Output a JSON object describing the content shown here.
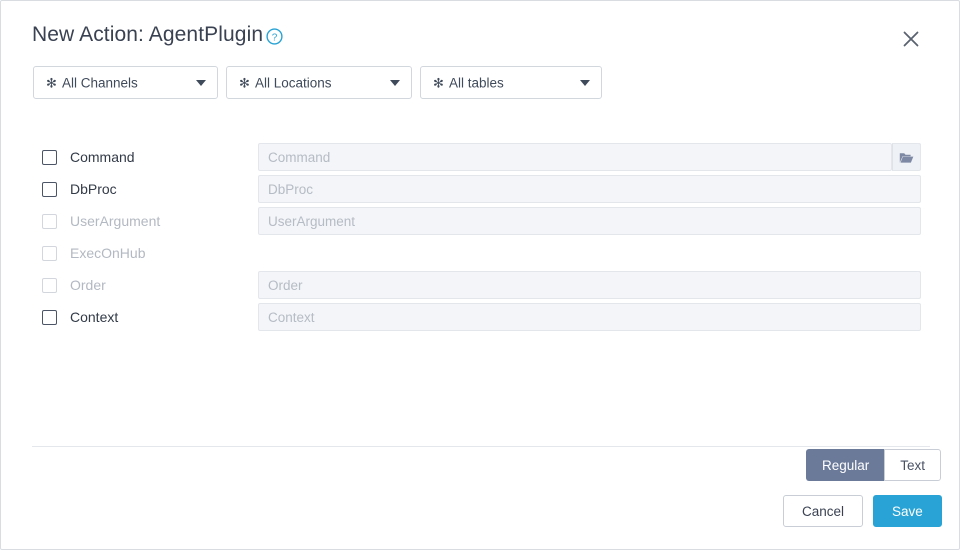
{
  "dialog": {
    "title": "New Action: AgentPlugin",
    "help_icon": "help-circle-icon",
    "close_icon": "close-icon"
  },
  "filters": [
    {
      "icon": "asterisk-icon",
      "star": "✻",
      "label": "All Channels",
      "caret": "chevron-down-icon",
      "name": "channels-select"
    },
    {
      "icon": "asterisk-icon",
      "star": "✻",
      "label": "All Locations",
      "caret": "chevron-down-icon",
      "name": "locations-select"
    },
    {
      "icon": "asterisk-icon",
      "star": "✻",
      "label": "All tables",
      "caret": "chevron-down-icon",
      "name": "tables-select"
    }
  ],
  "fields": [
    {
      "label": "Command",
      "placeholder": "Command",
      "value": "",
      "checked": false,
      "disabled": false,
      "has_input": true,
      "has_browse": true,
      "browse_icon": "folder-open-icon"
    },
    {
      "label": "DbProc",
      "placeholder": "DbProc",
      "value": "",
      "checked": false,
      "disabled": false,
      "has_input": true,
      "has_browse": false
    },
    {
      "label": "UserArgument",
      "placeholder": "UserArgument",
      "value": "",
      "checked": false,
      "disabled": true,
      "has_input": true,
      "has_browse": false
    },
    {
      "label": "ExecOnHub",
      "placeholder": "",
      "value": "",
      "checked": false,
      "disabled": true,
      "has_input": false,
      "has_browse": false
    },
    {
      "label": "Order",
      "placeholder": "Order",
      "value": "",
      "checked": false,
      "disabled": true,
      "has_input": true,
      "has_browse": false
    },
    {
      "label": "Context",
      "placeholder": "Context",
      "value": "",
      "checked": false,
      "disabled": false,
      "has_input": true,
      "has_browse": false
    }
  ],
  "view_toggle": {
    "options": [
      "Regular",
      "Text"
    ],
    "selected": "Regular"
  },
  "footer": {
    "cancel_label": "Cancel",
    "save_label": "Save"
  },
  "colors": {
    "accent_blue": "#29a3d5",
    "toggle_active": "#6b7a99",
    "text_dark": "#3a4252",
    "text_disabled": "#b3b9c2",
    "input_bg": "#f3f5f8"
  }
}
